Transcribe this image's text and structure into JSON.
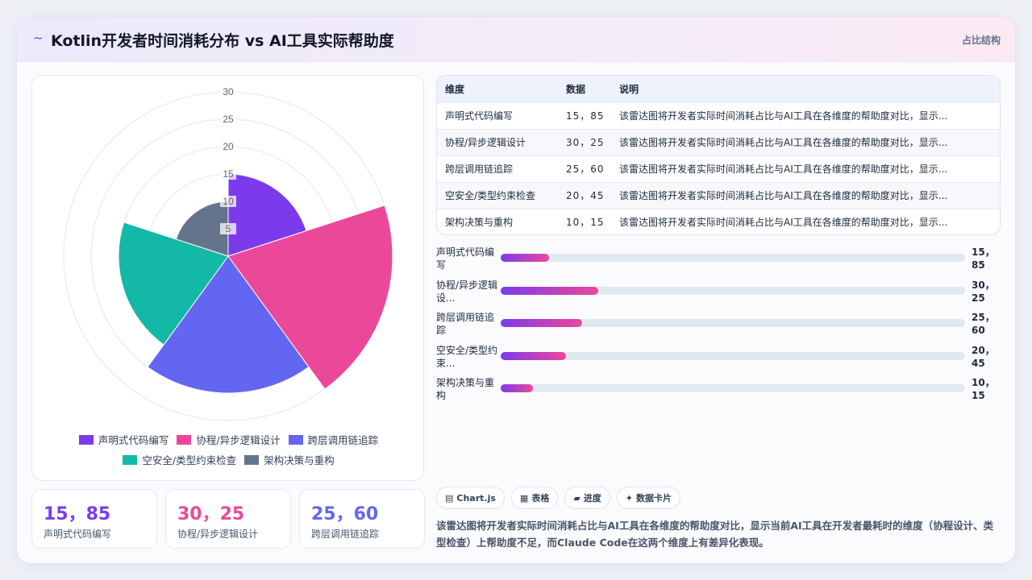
{
  "header": {
    "logo_icon": "~",
    "title": "Kotlin开发者时间消耗分布 vs AI工具实际帮助度",
    "tag": "占比结构"
  },
  "chart_data": {
    "type": "polarArea",
    "categories": [
      "声明式代码编写",
      "协程/异步逻辑设计",
      "跨层调用链追踪",
      "空安全/类型约束检查",
      "架构决策与重构"
    ],
    "values": [
      15,
      30,
      25,
      20,
      10
    ],
    "colors": [
      "#7c3aed",
      "#ec4899",
      "#6366f1",
      "#14b8a6",
      "#64748b"
    ],
    "rlim": [
      0,
      30
    ],
    "rticks": [
      5,
      10,
      15,
      20,
      25,
      30
    ],
    "legend_position": "bottom"
  },
  "kpis": [
    {
      "value": "15，85",
      "label": "声明式代码编写",
      "color": "#7c3aed"
    },
    {
      "value": "30，25",
      "label": "协程/异步逻辑设计",
      "color": "#ec4899"
    },
    {
      "value": "25，60",
      "label": "跨层调用链追踪",
      "color": "#6366f1"
    }
  ],
  "table": {
    "headers": [
      "维度",
      "数据",
      "说明"
    ],
    "rows": [
      [
        "声明式代码编写",
        "15，85",
        "该雷达图将开发者实际时间消耗占比与AI工具在各维度的帮助度对比，显示..."
      ],
      [
        "协程/异步逻辑设计",
        "30，25",
        "该雷达图将开发者实际时间消耗占比与AI工具在各维度的帮助度对比，显示..."
      ],
      [
        "跨层调用链追踪",
        "25，60",
        "该雷达图将开发者实际时间消耗占比与AI工具在各维度的帮助度对比，显示..."
      ],
      [
        "空安全/类型约束检查",
        "20，45",
        "该雷达图将开发者实际时间消耗占比与AI工具在各维度的帮助度对比，显示..."
      ],
      [
        "架构决策与重构",
        "10，15",
        "该雷达图将开发者实际时间消耗占比与AI工具在各维度的帮助度对比，显示..."
      ]
    ]
  },
  "bars": [
    {
      "label": "声明式代码编写",
      "value": "15，85",
      "fraction": 0.105
    },
    {
      "label": "协程/异步逻辑设...",
      "value": "30，25",
      "fraction": 0.21
    },
    {
      "label": "跨层调用链追踪",
      "value": "25，60",
      "fraction": 0.175
    },
    {
      "label": "空安全/类型约束...",
      "value": "20，45",
      "fraction": 0.14
    },
    {
      "label": "架构决策与重构",
      "value": "10，15",
      "fraction": 0.07
    }
  ],
  "tabs": [
    {
      "icon": "▤",
      "label": "Chart.js"
    },
    {
      "icon": "▦",
      "label": "表格"
    },
    {
      "icon": "▰",
      "label": "进度"
    },
    {
      "icon": "✦",
      "label": "数据卡片"
    }
  ],
  "summary": "该雷达图将开发者实际时间消耗占比与AI工具在各维度的帮助度对比，显示当前AI工具在开发者最耗时的维度（协程设计、类型检查）上帮助度不足，而Claude Code在这两个维度上有差异化表现。"
}
